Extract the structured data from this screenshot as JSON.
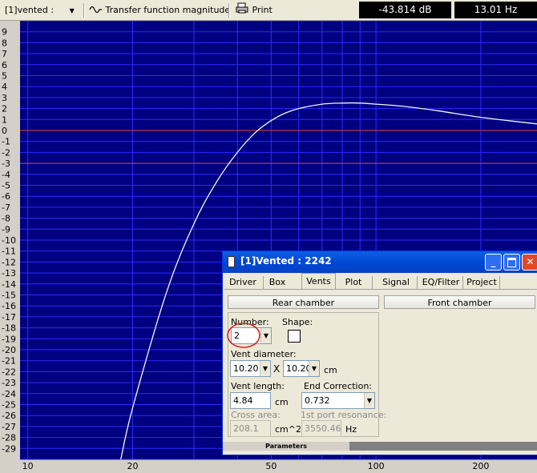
{
  "toolbar": {
    "driver_select": "[1]vented :",
    "graph_type_select": "Transfer function magnitude",
    "print_label": "Print",
    "level_readout": "-43.814 dB",
    "frequency_readout": "13.01 Hz"
  },
  "graph": {
    "y_ticks": [
      "9",
      "8",
      "7",
      "6",
      "5",
      "4",
      "3",
      "2",
      "1",
      "0",
      "-1",
      "-2",
      "-3",
      "-4",
      "-5",
      "-6",
      "-7",
      "-8",
      "-9",
      "-10",
      "-11",
      "-12",
      "-13",
      "-14",
      "-15",
      "-16",
      "-17",
      "-18",
      "-19",
      "-20",
      "-21",
      "-22",
      "-23",
      "-24",
      "-25",
      "-26",
      "-27",
      "-28",
      "-29"
    ],
    "x_tick_labels": [
      {
        "value": 10,
        "label": "10"
      },
      {
        "value": 20,
        "label": "20"
      },
      {
        "value": 50,
        "label": "50"
      },
      {
        "value": 100,
        "label": "100"
      },
      {
        "value": 200,
        "label": "200"
      }
    ],
    "reference_lines_db": [
      0,
      -3
    ],
    "colors": {
      "background": "#000080",
      "grid": "#2b2bff",
      "reference": "#b03a4a",
      "curve": "#f4f4f4"
    }
  },
  "chart_data": {
    "type": "line",
    "title": "",
    "xlabel": "",
    "ylabel": "",
    "x_scale": "log",
    "xlim": [
      9.5,
      290
    ],
    "ylim": [
      -30,
      10
    ],
    "grid": true,
    "series": [
      {
        "x": [
          18.5,
          20,
          25,
          30,
          35,
          40,
          45,
          50,
          55,
          60,
          70,
          80,
          90,
          100,
          120,
          150,
          200,
          290
        ],
        "y": [
          -30,
          -25.3,
          -14.8,
          -8.5,
          -4.6,
          -2.0,
          -0.2,
          0.9,
          1.6,
          2.0,
          2.4,
          2.5,
          2.5,
          2.4,
          2.2,
          1.8,
          1.2,
          0.6
        ]
      }
    ]
  },
  "dialog": {
    "title": "[1]Vented : 2242",
    "tabs": [
      "Driver",
      "Box",
      "Vents",
      "Plot",
      "Signal",
      "EQ/Filter",
      "Project"
    ],
    "active_tab": "Vents",
    "rear_chamber_label": "Rear chamber",
    "front_chamber_label": "Front chamber",
    "number_label": "Number:",
    "number_value": "2",
    "shape_label": "Shape:",
    "vent_diameter_label": "Vent diameter:",
    "diameter_1": "10.20",
    "x_symbol": "X",
    "diameter_2": "10.20",
    "diameter_unit": "cm",
    "vent_length_label": "Vent length:",
    "vent_length_value": "4.84",
    "length_unit": "cm",
    "end_correction_label": "End Correction:",
    "end_correction_value": "0.732",
    "cross_area_label": "Cross area:",
    "cross_area_value": "208.1",
    "cross_area_unit": "cm^2",
    "port_resonance_label": "1st port resonance:",
    "port_resonance_value": "3550.46",
    "port_resonance_unit": "Hz",
    "parameters_label": "Parameters",
    "highlight_color": "#e02020"
  }
}
